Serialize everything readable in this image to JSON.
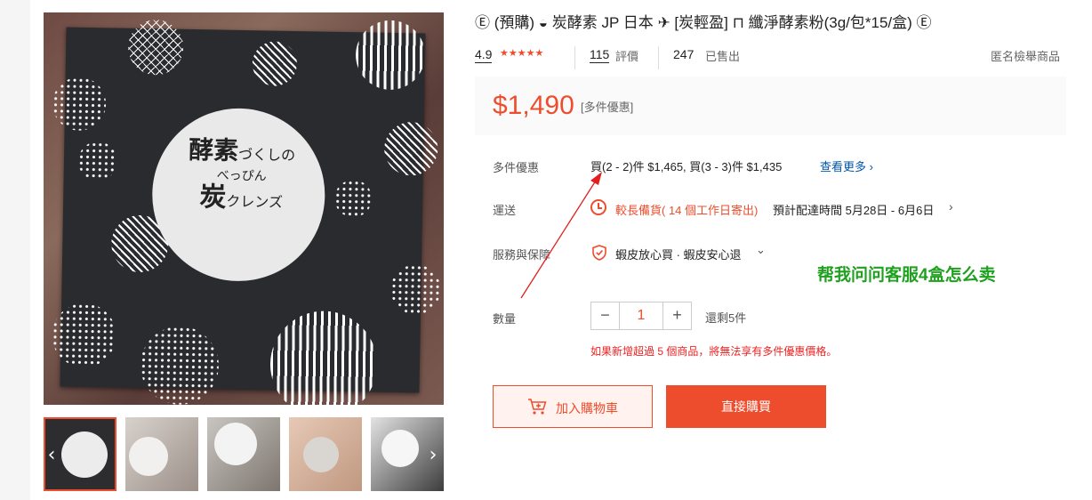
{
  "product": {
    "title": "Ⓔ (預購) ◒ 炭酵素 JP 日本 ✈ [炭輕盈] ⊓ 纖淨酵素粉(3g/包*15/盒) Ⓔ",
    "rating": "4.9",
    "stars": "★★★★★",
    "review_count": "115",
    "review_label": "評價",
    "sold_count": "247",
    "sold_label": "已售出",
    "report_link": "匿名檢舉商品",
    "price": "$1,490",
    "price_tag": "[多件優惠]",
    "package_text": {
      "line1_main": "酵素",
      "line1_small": "づくしの",
      "line2": "べっぴん",
      "line3_main": "炭",
      "line3_small": "クレンズ"
    }
  },
  "details": {
    "bundle_label": "多件優惠",
    "bundle_text": "買(2 - 2)件 $1,465, 買(3 - 3)件 $1,435",
    "see_more": "查看更多 ›",
    "shipping_label": "運送",
    "shipping_status": "較長備貨( 14 個工作日寄出)",
    "shipping_eta": "預計配達時間 5月28日 - 6月6日",
    "service_label": "服務與保障",
    "service_text": "蝦皮放心買 · 蝦皮安心退",
    "quantity_label": "數量",
    "quantity_value": "1",
    "stock_text": "還剩5件",
    "warning_text": "如果新增超過 5 個商品，將無法享有多件優惠價格。"
  },
  "buttons": {
    "add_to_cart": "加入購物車",
    "buy_now": "直接購買",
    "minus": "−",
    "plus": "+"
  },
  "annotation": "帮我问问客服4盒怎么卖",
  "colors": {
    "accent": "#ee4d2d",
    "annotation": "#1fa01f",
    "link": "#0055aa"
  },
  "icons": {
    "prev": "‹",
    "next": "›",
    "ship_chevron": "›",
    "service_chevron": "⌄"
  }
}
